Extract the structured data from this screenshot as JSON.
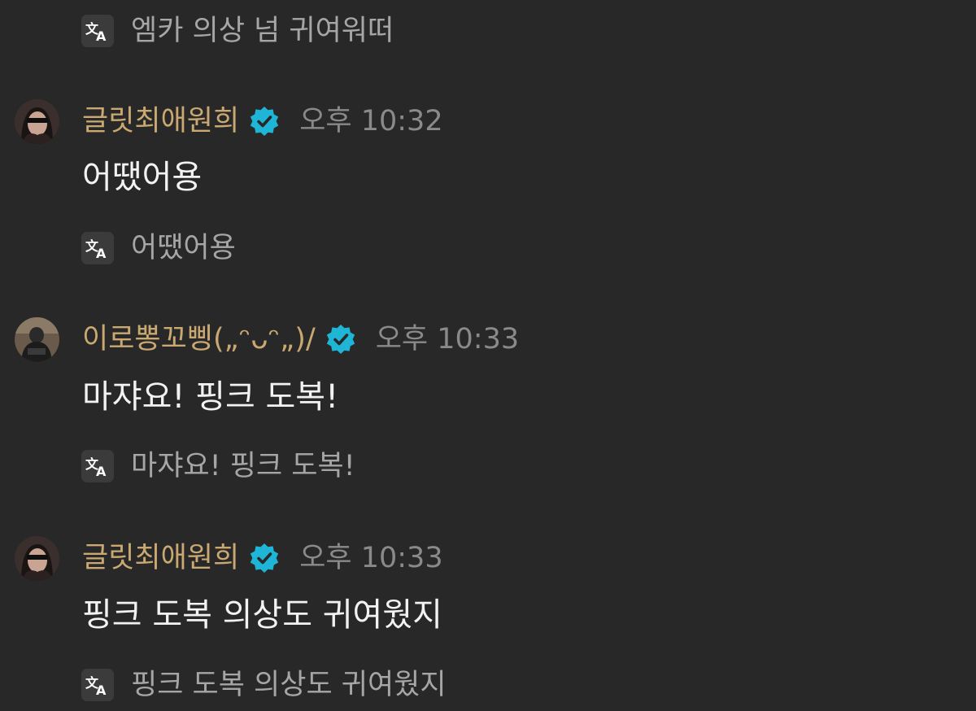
{
  "translate_icon": "translate-icon",
  "verified_icon": "verified-badge-icon",
  "colors": {
    "background": "#282828",
    "username": "#c9a872",
    "verified": "#1fb5d6",
    "message": "#f2f2f2",
    "translation": "#a6a6a6",
    "timestamp": "#8a8a8a"
  },
  "top_translation": "엠카 의상 넘 귀여워떠",
  "messages": [
    {
      "author": "글릿최애원희",
      "time": "오후 10:32",
      "text": "어땠어용",
      "translation": "어땠어용"
    },
    {
      "author": "이로뽕꼬삥(„ᵔᴗᵔ„)/",
      "time": "오후 10:33",
      "text": "마쟈요! 핑크 도복!",
      "translation": "마쟈요! 핑크 도복!"
    },
    {
      "author": "글릿최애원희",
      "time": "오후 10:33",
      "text": "핑크 도복 의상도 귀여웠지",
      "translation": "핑크 도복 의상도 귀여웠지"
    }
  ]
}
